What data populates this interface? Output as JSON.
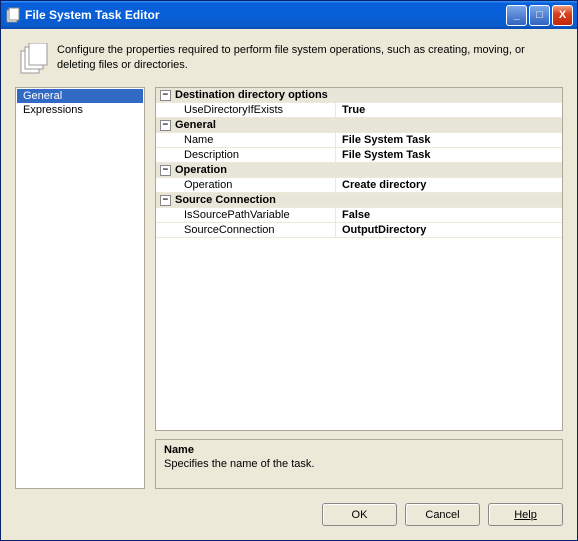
{
  "window": {
    "title": "File System Task Editor"
  },
  "header": {
    "text": "Configure the properties required to perform file system operations, such as creating, moving, or deleting files or directories."
  },
  "sidebar": {
    "items": [
      {
        "label": "General",
        "selected": true
      },
      {
        "label": "Expressions",
        "selected": false
      }
    ]
  },
  "grid": {
    "categories": [
      {
        "label": "Destination directory options",
        "rows": [
          {
            "name": "UseDirectoryIfExists",
            "value": "True"
          }
        ]
      },
      {
        "label": "General",
        "rows": [
          {
            "name": "Name",
            "value": "File System Task"
          },
          {
            "name": "Description",
            "value": "File System Task"
          }
        ]
      },
      {
        "label": "Operation",
        "rows": [
          {
            "name": "Operation",
            "value": "Create directory"
          }
        ]
      },
      {
        "label": "Source Connection",
        "rows": [
          {
            "name": "IsSourcePathVariable",
            "value": "False"
          },
          {
            "name": "SourceConnection",
            "value": "OutputDirectory"
          }
        ]
      }
    ]
  },
  "description": {
    "title": "Name",
    "body": "Specifies the name of the task."
  },
  "buttons": {
    "ok": "OK",
    "cancel": "Cancel",
    "help": "Help"
  },
  "glyphs": {
    "minimize": "_",
    "maximize": "□",
    "close": "X",
    "minus": "−"
  }
}
